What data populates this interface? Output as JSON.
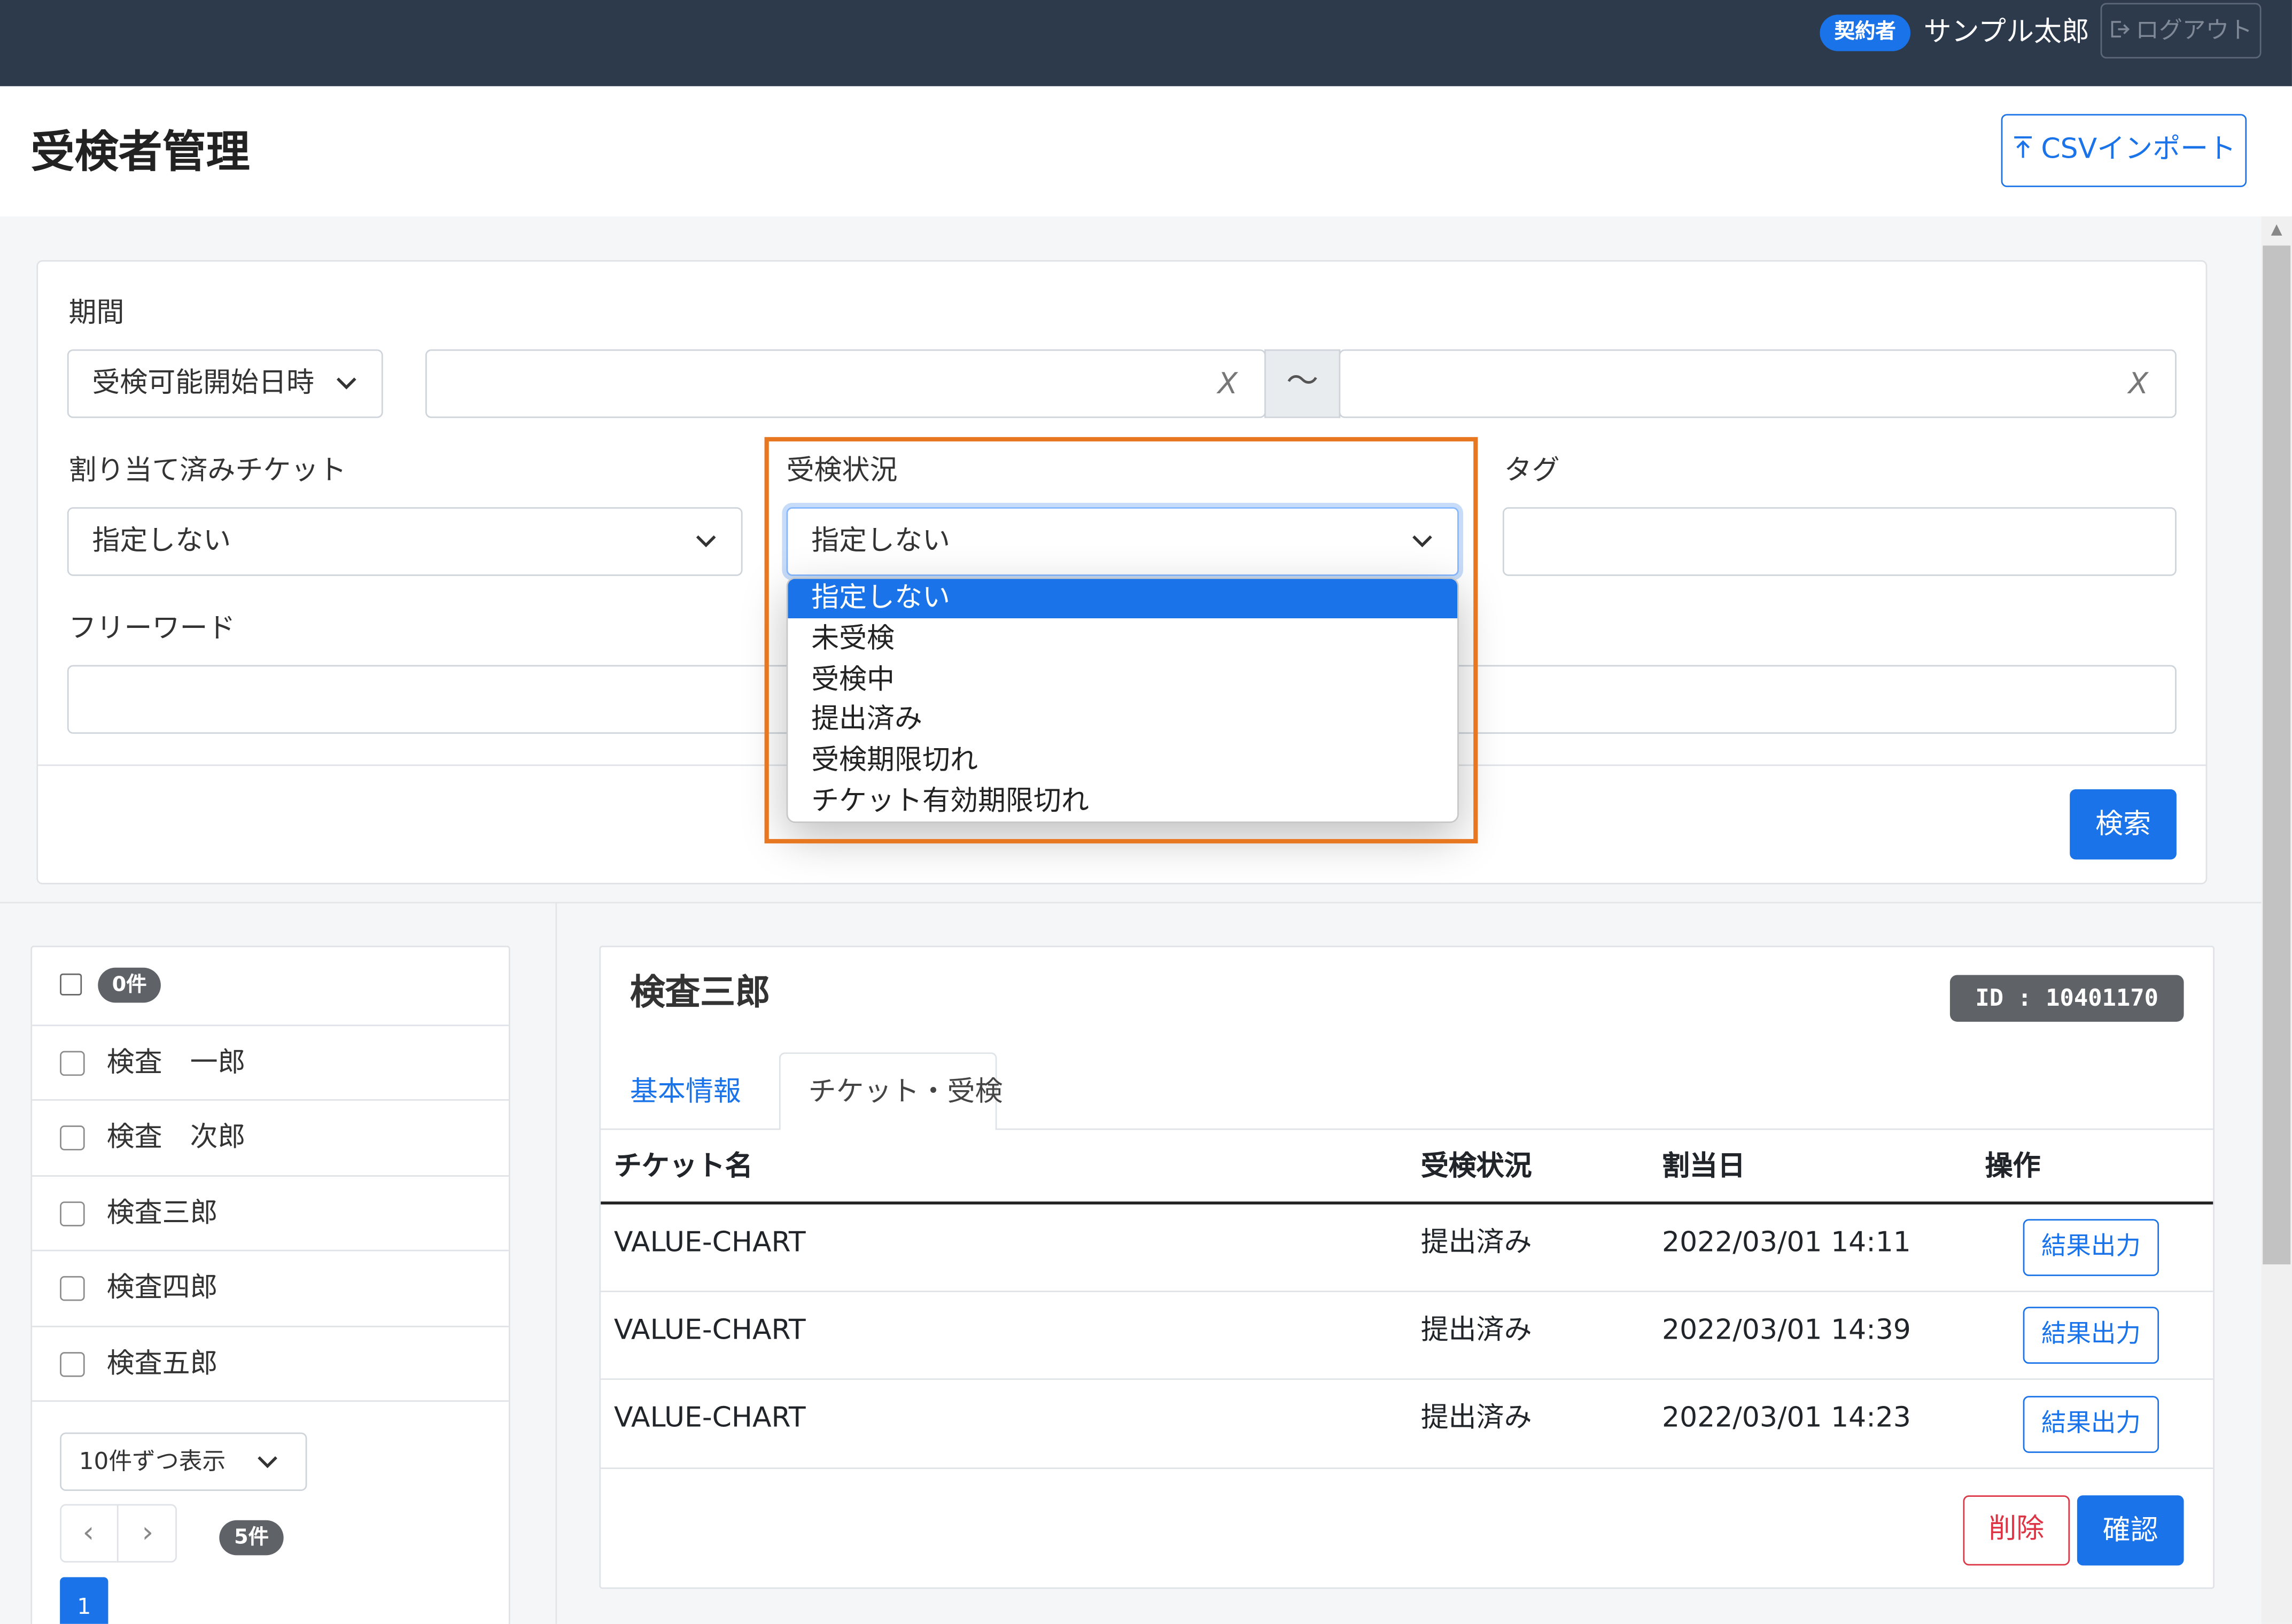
{
  "topbar": {
    "role_badge": "契約者",
    "user_name": "サンプル太郎",
    "logout_label": "ログアウト"
  },
  "page": {
    "title": "受検者管理",
    "csv_import_label": "CSVインポート"
  },
  "filters": {
    "period_label": "期間",
    "period_select": "受検可能開始日時",
    "clear_mark": "X",
    "range_sep": "〜",
    "ticket_label": "割り当て済みチケット",
    "ticket_select": "指定しない",
    "status_label": "受検状況",
    "status_select": "指定しない",
    "status_options": [
      "指定しない",
      "未受検",
      "受検中",
      "提出済み",
      "受検期限切れ",
      "チケット有効期限切れ"
    ],
    "tag_label": "タグ",
    "freeword_label": "フリーワード",
    "search_label": "検索"
  },
  "list": {
    "count_badge": "0件",
    "people": [
      "検査　一郎",
      "検査　次郎",
      "検査三郎",
      "検査四郎",
      "検査五郎"
    ],
    "per_page": "10件ずつ表示",
    "prev": "‹",
    "next": "›",
    "total_badge": "5件",
    "current_page": "1"
  },
  "detail": {
    "name": "検査三郎",
    "id_badge": "ID : 10401170",
    "tabs": [
      "基本情報",
      "チケット・受検"
    ],
    "columns": [
      "チケット名",
      "受検状況",
      "割当日",
      "操作"
    ],
    "rows": [
      {
        "ticket": "VALUE-CHART",
        "status": "提出済み",
        "date": "2022/03/01 14:11",
        "action": "結果出力"
      },
      {
        "ticket": "VALUE-CHART",
        "status": "提出済み",
        "date": "2022/03/01 14:39",
        "action": "結果出力"
      },
      {
        "ticket": "VALUE-CHART",
        "status": "提出済み",
        "date": "2022/03/01 14:23",
        "action": "結果出力"
      }
    ],
    "delete_label": "削除",
    "confirm_label": "確認"
  },
  "colors": {
    "topbar": "#2d3a4b",
    "accent": "#1a73e8",
    "highlight": "#e87722",
    "danger": "#dc3545"
  }
}
